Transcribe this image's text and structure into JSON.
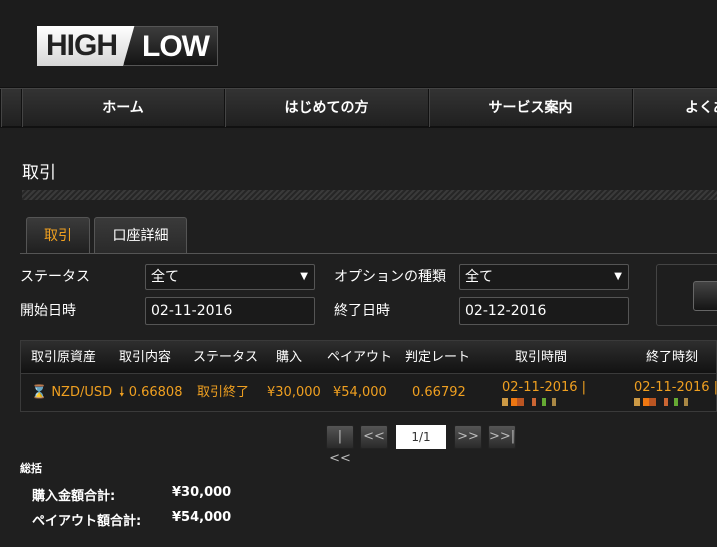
{
  "brand": {
    "logo_high": "HIGH",
    "logo_low": "LOW"
  },
  "nav": [
    {
      "label": "ホーム"
    },
    {
      "label": "はじめての方"
    },
    {
      "label": "サービス案内"
    },
    {
      "label": "よくあ"
    }
  ],
  "page_title": "取引",
  "tabs": [
    {
      "label": "取引",
      "active": true
    },
    {
      "label": "口座詳細",
      "active": false
    }
  ],
  "filters": {
    "status_label": "ステータス",
    "status_value": "全て",
    "option_type_label": "オプションの種類",
    "option_type_value": "全て",
    "start_label": "開始日時",
    "start_value": "02-11-2016",
    "end_label": "終了日時",
    "end_value": "02-12-2016"
  },
  "table": {
    "headers": [
      "取引原資産",
      "取引内容",
      "ステータス",
      "購入",
      "ペイアウト",
      "判定レート",
      "取引時間",
      "終了時刻"
    ],
    "rows": [
      {
        "asset": "NZD/USD",
        "direction_icon": "arrow-down-icon",
        "entry": "0.66808",
        "status": "取引終了",
        "purchase": "¥30,000",
        "payout": "¥54,000",
        "rate": "0.66792",
        "trade_time": "02-11-2016 |",
        "end_time": "02-11-2016 |"
      }
    ]
  },
  "pager": {
    "first": "|<<",
    "prev": "<<",
    "page": "1/1",
    "next": ">>",
    "last": ">>|"
  },
  "summary": {
    "title": "総括",
    "purchase_label": "購入金額合計:",
    "purchase_value": "¥30,000",
    "payout_label": "ペイアウト額合計:",
    "payout_value": "¥54,000"
  },
  "colors": {
    "accent": "#f0a020",
    "background": "#1f1f1f"
  }
}
